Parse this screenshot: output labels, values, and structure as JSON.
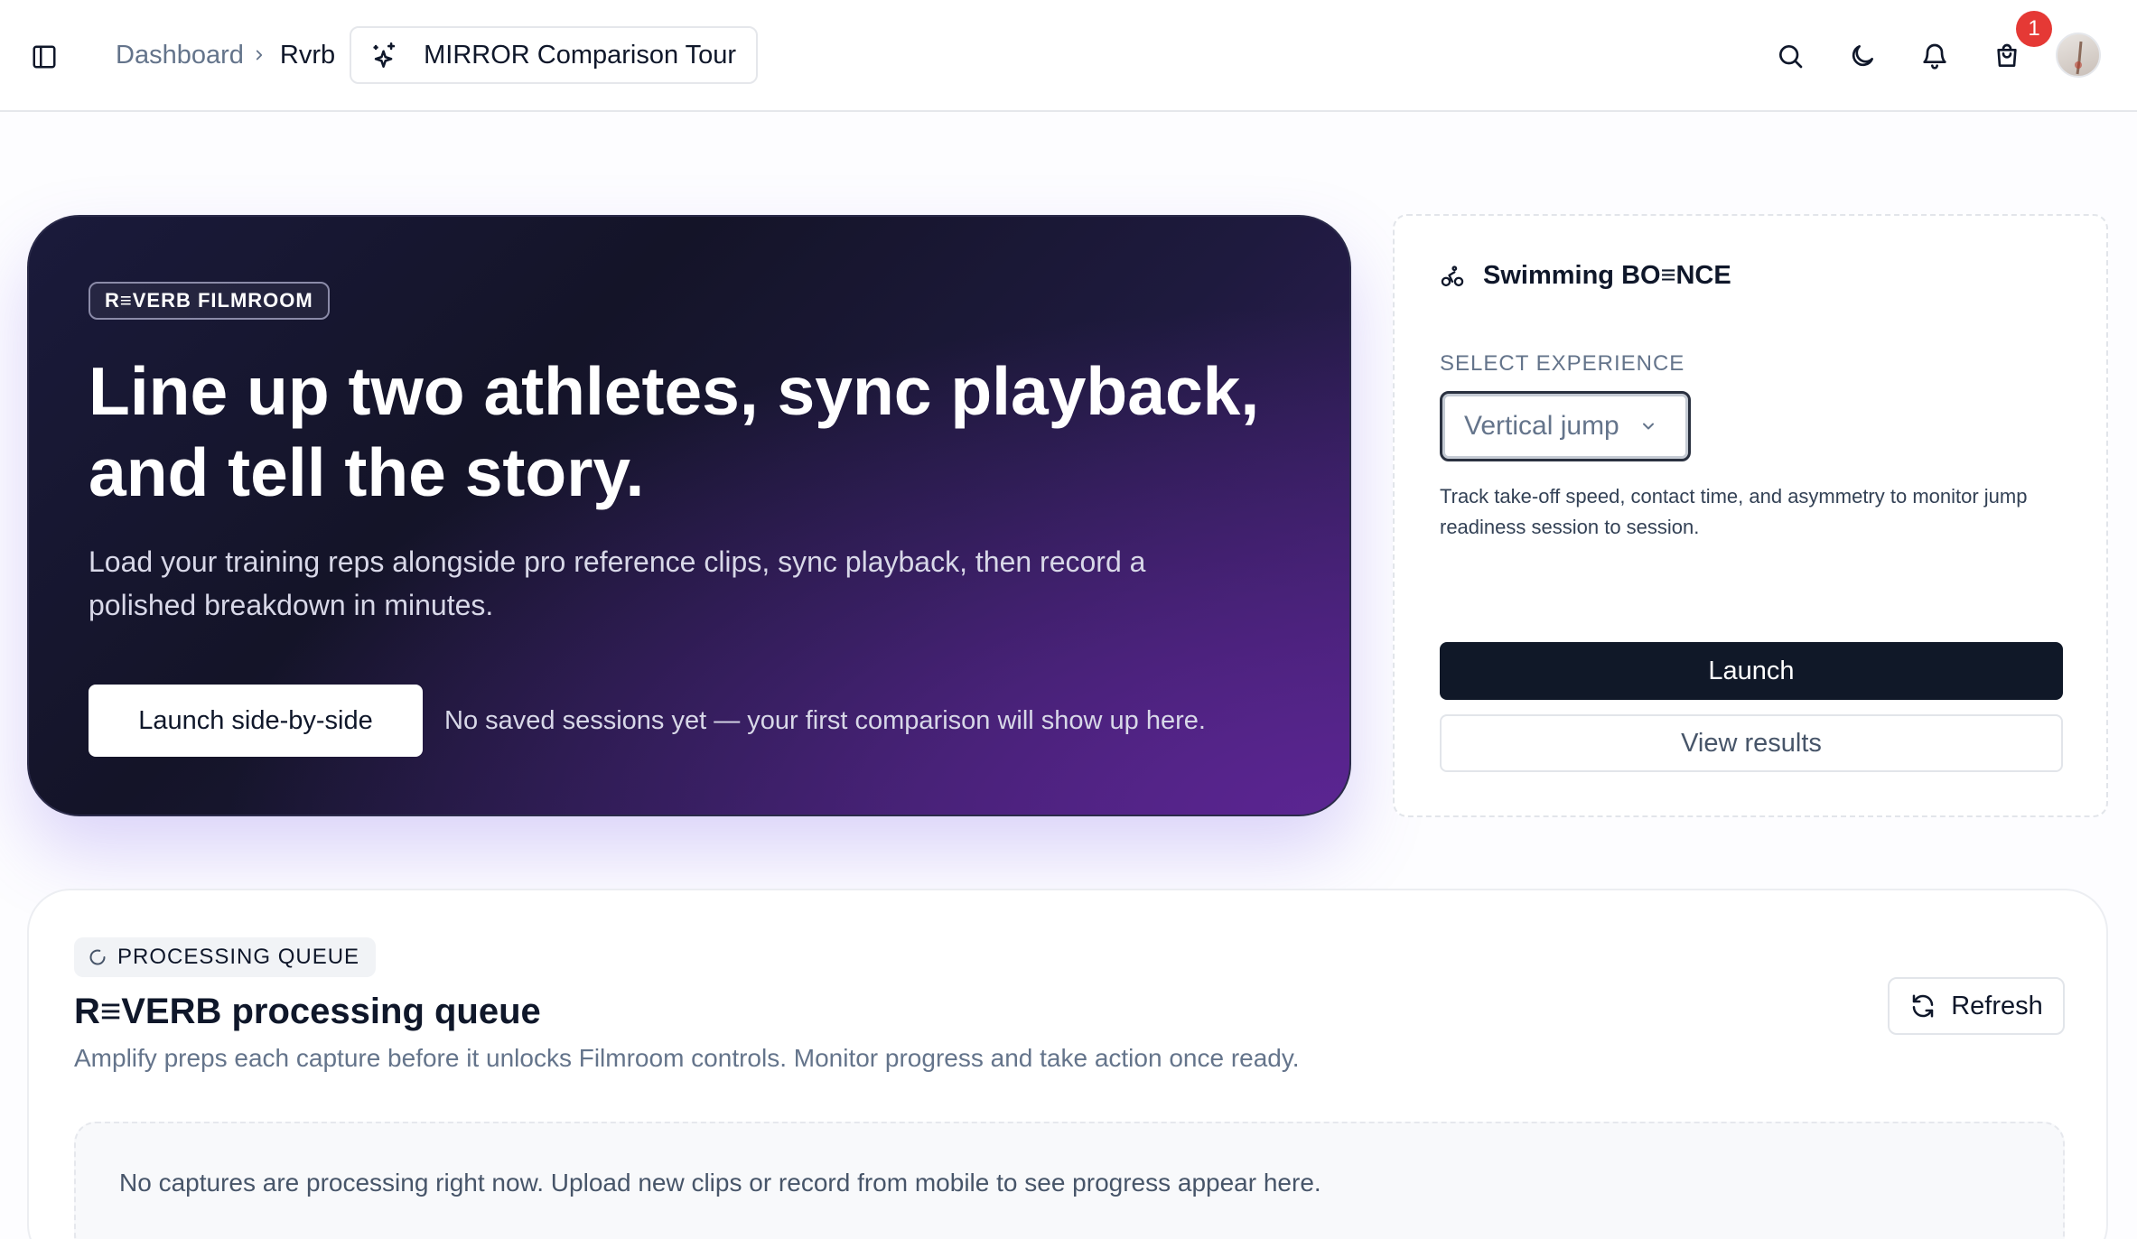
{
  "header": {
    "breadcrumb": [
      {
        "label": "Dashboard"
      },
      {
        "label": "Rvrb"
      }
    ],
    "tour_button": {
      "label": "MIRROR Comparison Tour",
      "icon": "sparkles-icon"
    },
    "icons": [
      "sidebar-toggle-icon",
      "search-icon",
      "moon-icon",
      "bell-icon",
      "shopping-bag-icon"
    ],
    "cart_badge_count": "1"
  },
  "hero": {
    "badge": "R≡VERB FILMROOM",
    "title": "Line up two athletes, sync playback, and tell the story.",
    "description": "Load your training reps alongside pro reference clips, sync playback, then record a polished breakdown in minutes.",
    "cta_label": "Launch side-by-side",
    "note": "No saved sessions yet — your first comparison will show up here."
  },
  "experience": {
    "title": "Swimming BO≡NCE",
    "select_label": "SELECT EXPERIENCE",
    "selected_value": "Vertical jump",
    "hint": "Track take-off speed, contact time, and asymmetry to monitor jump readiness session to session.",
    "launch_label": "Launch",
    "view_results_label": "View results"
  },
  "queue": {
    "chip": "PROCESSING QUEUE",
    "title": "R≡VERB processing queue",
    "description": "Amplify preps each capture before it unlocks Filmroom controls. Monitor progress and take action once ready.",
    "refresh_label": "Refresh",
    "empty_message": "No captures are processing right now. Upload new clips or record from mobile to see progress appear here."
  },
  "colors": {
    "hero_bg_dark": "#141428",
    "hero_bg_accent": "#5b2592",
    "primary_button": "#101828",
    "badge_red": "#e53935"
  }
}
